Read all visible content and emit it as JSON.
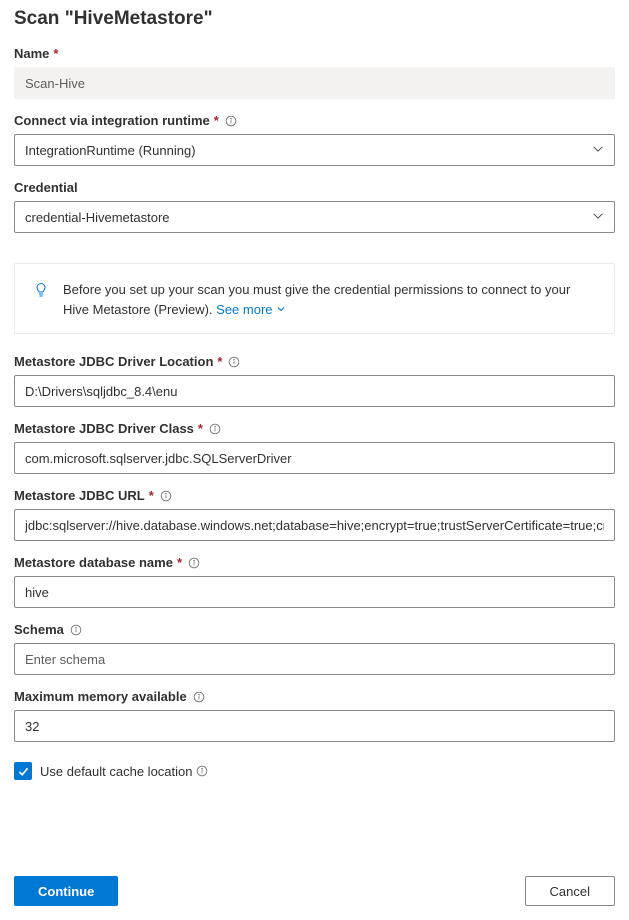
{
  "pageTitle": "Scan \"HiveMetastore\"",
  "fields": {
    "name": {
      "label": "Name",
      "required": true,
      "info": false,
      "value": "Scan-Hive",
      "readonly": true
    },
    "integrationRuntime": {
      "label": "Connect via integration runtime",
      "required": true,
      "info": true,
      "selected": "IntegrationRuntime (Running)"
    },
    "credential": {
      "label": "Credential",
      "required": false,
      "info": false,
      "selected": "credential-Hivemetastore"
    },
    "jdbcDriverLocation": {
      "label": "Metastore JDBC Driver Location",
      "required": true,
      "info": true,
      "value": "D:\\Drivers\\sqljdbc_8.4\\enu"
    },
    "jdbcDriverClass": {
      "label": "Metastore JDBC Driver Class",
      "required": true,
      "info": true,
      "value": "com.microsoft.sqlserver.jdbc.SQLServerDriver"
    },
    "jdbcUrl": {
      "label": "Metastore JDBC URL",
      "required": true,
      "info": true,
      "value": "jdbc:sqlserver://hive.database.windows.net;database=hive;encrypt=true;trustServerCertificate=true;create=fal"
    },
    "databaseName": {
      "label": "Metastore database name",
      "required": true,
      "info": true,
      "value": "hive"
    },
    "schema": {
      "label": "Schema",
      "required": false,
      "info": true,
      "value": "",
      "placeholder": "Enter schema"
    },
    "maxMemory": {
      "label": "Maximum memory available",
      "required": false,
      "info": true,
      "value": "32"
    },
    "useDefaultCache": {
      "label": "Use default cache location",
      "info": true,
      "checked": true
    }
  },
  "callout": {
    "text": "Before you set up your scan you must give the credential permissions to connect to your Hive Metastore (Preview). ",
    "link": "See more"
  },
  "buttons": {
    "continue": "Continue",
    "cancel": "Cancel"
  }
}
